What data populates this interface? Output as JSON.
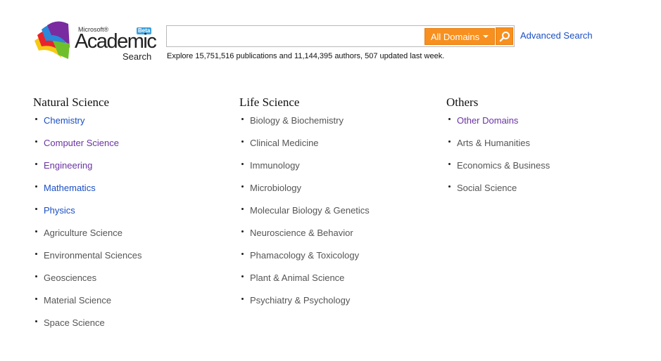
{
  "logo": {
    "microsoft": "Microsoft®",
    "academic": "Academic",
    "search": "Search",
    "beta": "Beta"
  },
  "search": {
    "value": "",
    "placeholder": "",
    "domains_label": "All Domains",
    "go_icon": "search-icon"
  },
  "advanced_search": "Advanced Search",
  "explore_text": "Explore 15,751,516 publications and 11,144,395 authors, 507 updated last week.",
  "columns": [
    {
      "title": "Natural Science",
      "items": [
        {
          "label": "Chemistry",
          "style": "link-blue"
        },
        {
          "label": "Computer Science",
          "style": "link-visited"
        },
        {
          "label": "Engineering",
          "style": "link-visited"
        },
        {
          "label": "Mathematics",
          "style": "link-blue"
        },
        {
          "label": "Physics",
          "style": "link-blue"
        },
        {
          "label": "Agriculture Science",
          "style": "text"
        },
        {
          "label": "Environmental Sciences",
          "style": "text"
        },
        {
          "label": "Geosciences",
          "style": "text"
        },
        {
          "label": "Material Science",
          "style": "text"
        },
        {
          "label": "Space Science",
          "style": "text"
        }
      ]
    },
    {
      "title": "Life Science",
      "items": [
        {
          "label": "Biology & Biochemistry",
          "style": "text"
        },
        {
          "label": "Clinical Medicine",
          "style": "text"
        },
        {
          "label": "Immunology",
          "style": "text"
        },
        {
          "label": "Microbiology",
          "style": "text"
        },
        {
          "label": "Molecular Biology & Genetics",
          "style": "text"
        },
        {
          "label": "Neuroscience & Behavior",
          "style": "text"
        },
        {
          "label": "Phamacology & Toxicology",
          "style": "text"
        },
        {
          "label": "Plant & Animal Science",
          "style": "text"
        },
        {
          "label": "Psychiatry & Psychology",
          "style": "text"
        }
      ]
    },
    {
      "title": "Others",
      "items": [
        {
          "label": "Other Domains",
          "style": "link-visited"
        },
        {
          "label": "Arts & Humanities",
          "style": "text"
        },
        {
          "label": "Economics & Business",
          "style": "text"
        },
        {
          "label": "Social Science",
          "style": "text"
        }
      ]
    }
  ],
  "colors": {
    "accent_orange": "#f7901e",
    "link_blue": "#1a4fc4",
    "link_visited": "#6a33a3",
    "text_gray": "#555555"
  }
}
